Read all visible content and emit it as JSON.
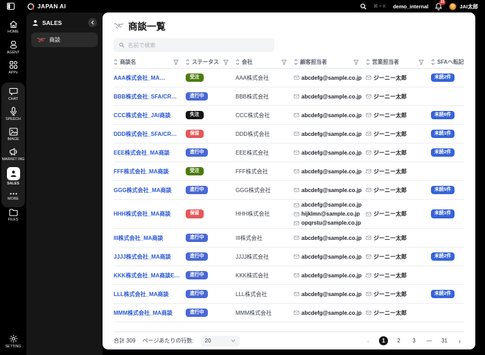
{
  "topbar": {
    "logo_text": "JAPAN AI",
    "search_shortcut": "⌘ + K",
    "workspace": "demo_internal",
    "notification_count": "13",
    "user_name": "JAI太郎"
  },
  "rail": {
    "items": [
      {
        "label": "HOME"
      },
      {
        "label": "AGENT"
      },
      {
        "label": "APPs"
      },
      {
        "label": "CHAT"
      },
      {
        "label": "SPEECH"
      },
      {
        "label": "IMAGE"
      },
      {
        "label": "MARKET ING"
      },
      {
        "label": "SALES"
      },
      {
        "label": "MORE"
      },
      {
        "label": "FILES"
      },
      {
        "label": "SETTING"
      }
    ]
  },
  "subsidebar": {
    "title": "SALES",
    "items": [
      {
        "label": "商談"
      }
    ]
  },
  "main": {
    "title": "商談一覧",
    "search_placeholder": "名前で検索",
    "table": {
      "columns": [
        "商談名",
        "ステータス",
        "会社",
        "顧客担当者",
        "営業担当者",
        "SFAへ転記"
      ],
      "rows": [
        {
          "name": "AAA株式会社_MA…",
          "status": "受注",
          "company": "AAA株式会社",
          "contacts": [
            "abcdefg@sample.co.jp"
          ],
          "sales_rep": "ジーニー太郎",
          "unread": "未読2件"
        },
        {
          "name": "BBB株式会社_SFA/CR…",
          "status": "進行中",
          "company": "BBB株式会社",
          "contacts": [
            "abcdefg@sample.co.jp"
          ],
          "sales_rep": "ジーニー太郎",
          "unread": null
        },
        {
          "name": "CCC株式会社_JAI商談",
          "status": "失注",
          "company": "CCC株式会社",
          "contacts": [
            "abcdefg@sample.co.jp"
          ],
          "sales_rep": "ジーニー太郎",
          "unread": "未読6件"
        },
        {
          "name": "DDD株式会社_SFA/CR…",
          "status": "保留",
          "company": "DDD株式会社",
          "contacts": [
            "abcdefg@sample.co.jp"
          ],
          "sales_rep": "ジーニー太郎",
          "unread": "未読1件"
        },
        {
          "name": "EEE株式会社_MA商談",
          "status": "進行中",
          "company": "EEE株式会社",
          "contacts": [
            "abcdefg@sample.co.jp"
          ],
          "sales_rep": "ジーニー太郎",
          "unread": "未読2件"
        },
        {
          "name": "FFF株式会社_MA商談",
          "status": "受注",
          "company": "FFF株式会社",
          "contacts": [
            "abcdefg@sample.co.jp"
          ],
          "sales_rep": "ジーニー太郎",
          "unread": null
        },
        {
          "name": "GGG株式会社_MA商談",
          "status": "進行中",
          "company": "GGG株式会社",
          "contacts": [
            "abcdefg@sample.co.jp"
          ],
          "sales_rep": "ジーニー太郎",
          "unread": "未読5件"
        },
        {
          "name": "HHH株式会社_MA商談",
          "status": "保留",
          "company": "HHH株式会社",
          "contacts": [
            "abcdefg@sample.co.jp",
            "hijklmn@sample.co.jp",
            "opqrstu@sample.co.jp"
          ],
          "sales_rep": "ジーニー太郎",
          "unread": "未読1件"
        },
        {
          "name": "III株式会社_MA商談",
          "status": "進行中",
          "company": "III株式会社",
          "contacts": [
            "abcdefg@sample.co.jp"
          ],
          "sales_rep": "ジーニー太郎",
          "unread": null
        },
        {
          "name": "JJJJ株式会社_MA商談",
          "status": "進行中",
          "company": "JJJJ株式会社",
          "contacts": [
            "abcdefg@sample.co.jp"
          ],
          "sales_rep": "ジーニー太郎",
          "unread": "未読2件"
        },
        {
          "name": "KKK株式会社_MA商談E…",
          "status": "進行中",
          "company": "KKK株式会社",
          "contacts": [
            "abcdefg@sample.co.jp"
          ],
          "sales_rep": "ジーニー太郎",
          "unread": null
        },
        {
          "name": "LLL株式会社_MA商談",
          "status": "進行中",
          "company": "LLL株式会社",
          "contacts": [
            "abcdefg@sample.co.jp"
          ],
          "sales_rep": "ジーニー太郎",
          "unread": "未読2件"
        },
        {
          "name": "MMM株式会社_MA商談",
          "status": "進行中",
          "company": "MMM株式会社",
          "contacts": [
            "abcdefg@sample.co.jp"
          ],
          "sales_rep": "ジーニー太郎",
          "unread": null
        }
      ]
    },
    "footer": {
      "total_label": "合計 309",
      "rows_per_page_label": "ページあたりの行数:",
      "rows_per_page_value": "20",
      "pages": [
        "1",
        "2",
        "3",
        "—",
        "31"
      ],
      "active_page": "1"
    }
  },
  "colors": {
    "status": {
      "受注": "#4d7c0f",
      "進行中": "#4968d6",
      "失注": "#141414",
      "保留": "#e4585a"
    },
    "unread_badge": "#3563d9",
    "link": "#2f5cd6"
  }
}
